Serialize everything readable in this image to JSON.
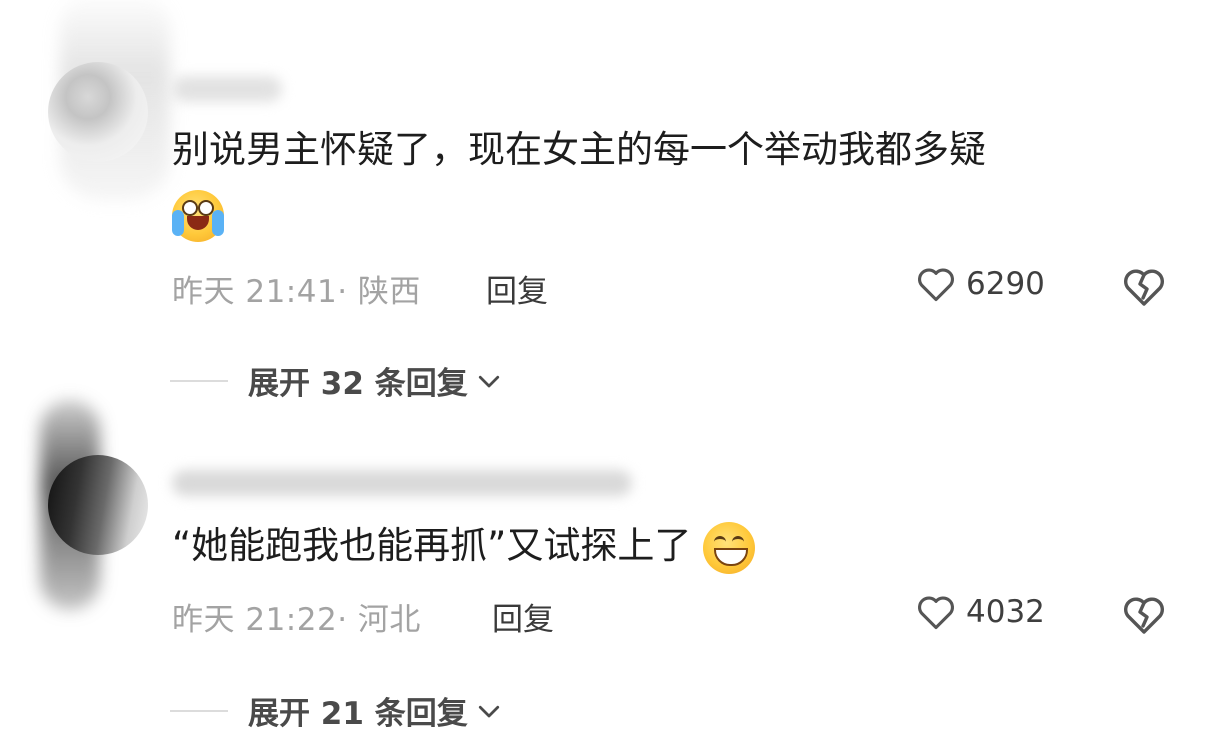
{
  "comments": [
    {
      "text": "别说男主怀疑了，现在女主的每一个举动我都多疑",
      "emoji": "loudly-crying-face",
      "time": "昨天 21:41· 陕西",
      "reply_label": "回复",
      "likes": "6290",
      "expand_label": "展开 32 条回复"
    },
    {
      "text": "“她能跑我也能再抓”又试探上了",
      "emoji": "grinning-squinting-face",
      "time": "昨天 21:22· 河北",
      "reply_label": "回复",
      "likes": "4032",
      "expand_label": "展开 21 条回复"
    }
  ],
  "colors": {
    "text": "#1d1d1d",
    "meta": "#a3a3a3",
    "icon": "#505050"
  },
  "icons": [
    "heart-icon",
    "broken-heart-icon",
    "chevron-down-icon"
  ]
}
